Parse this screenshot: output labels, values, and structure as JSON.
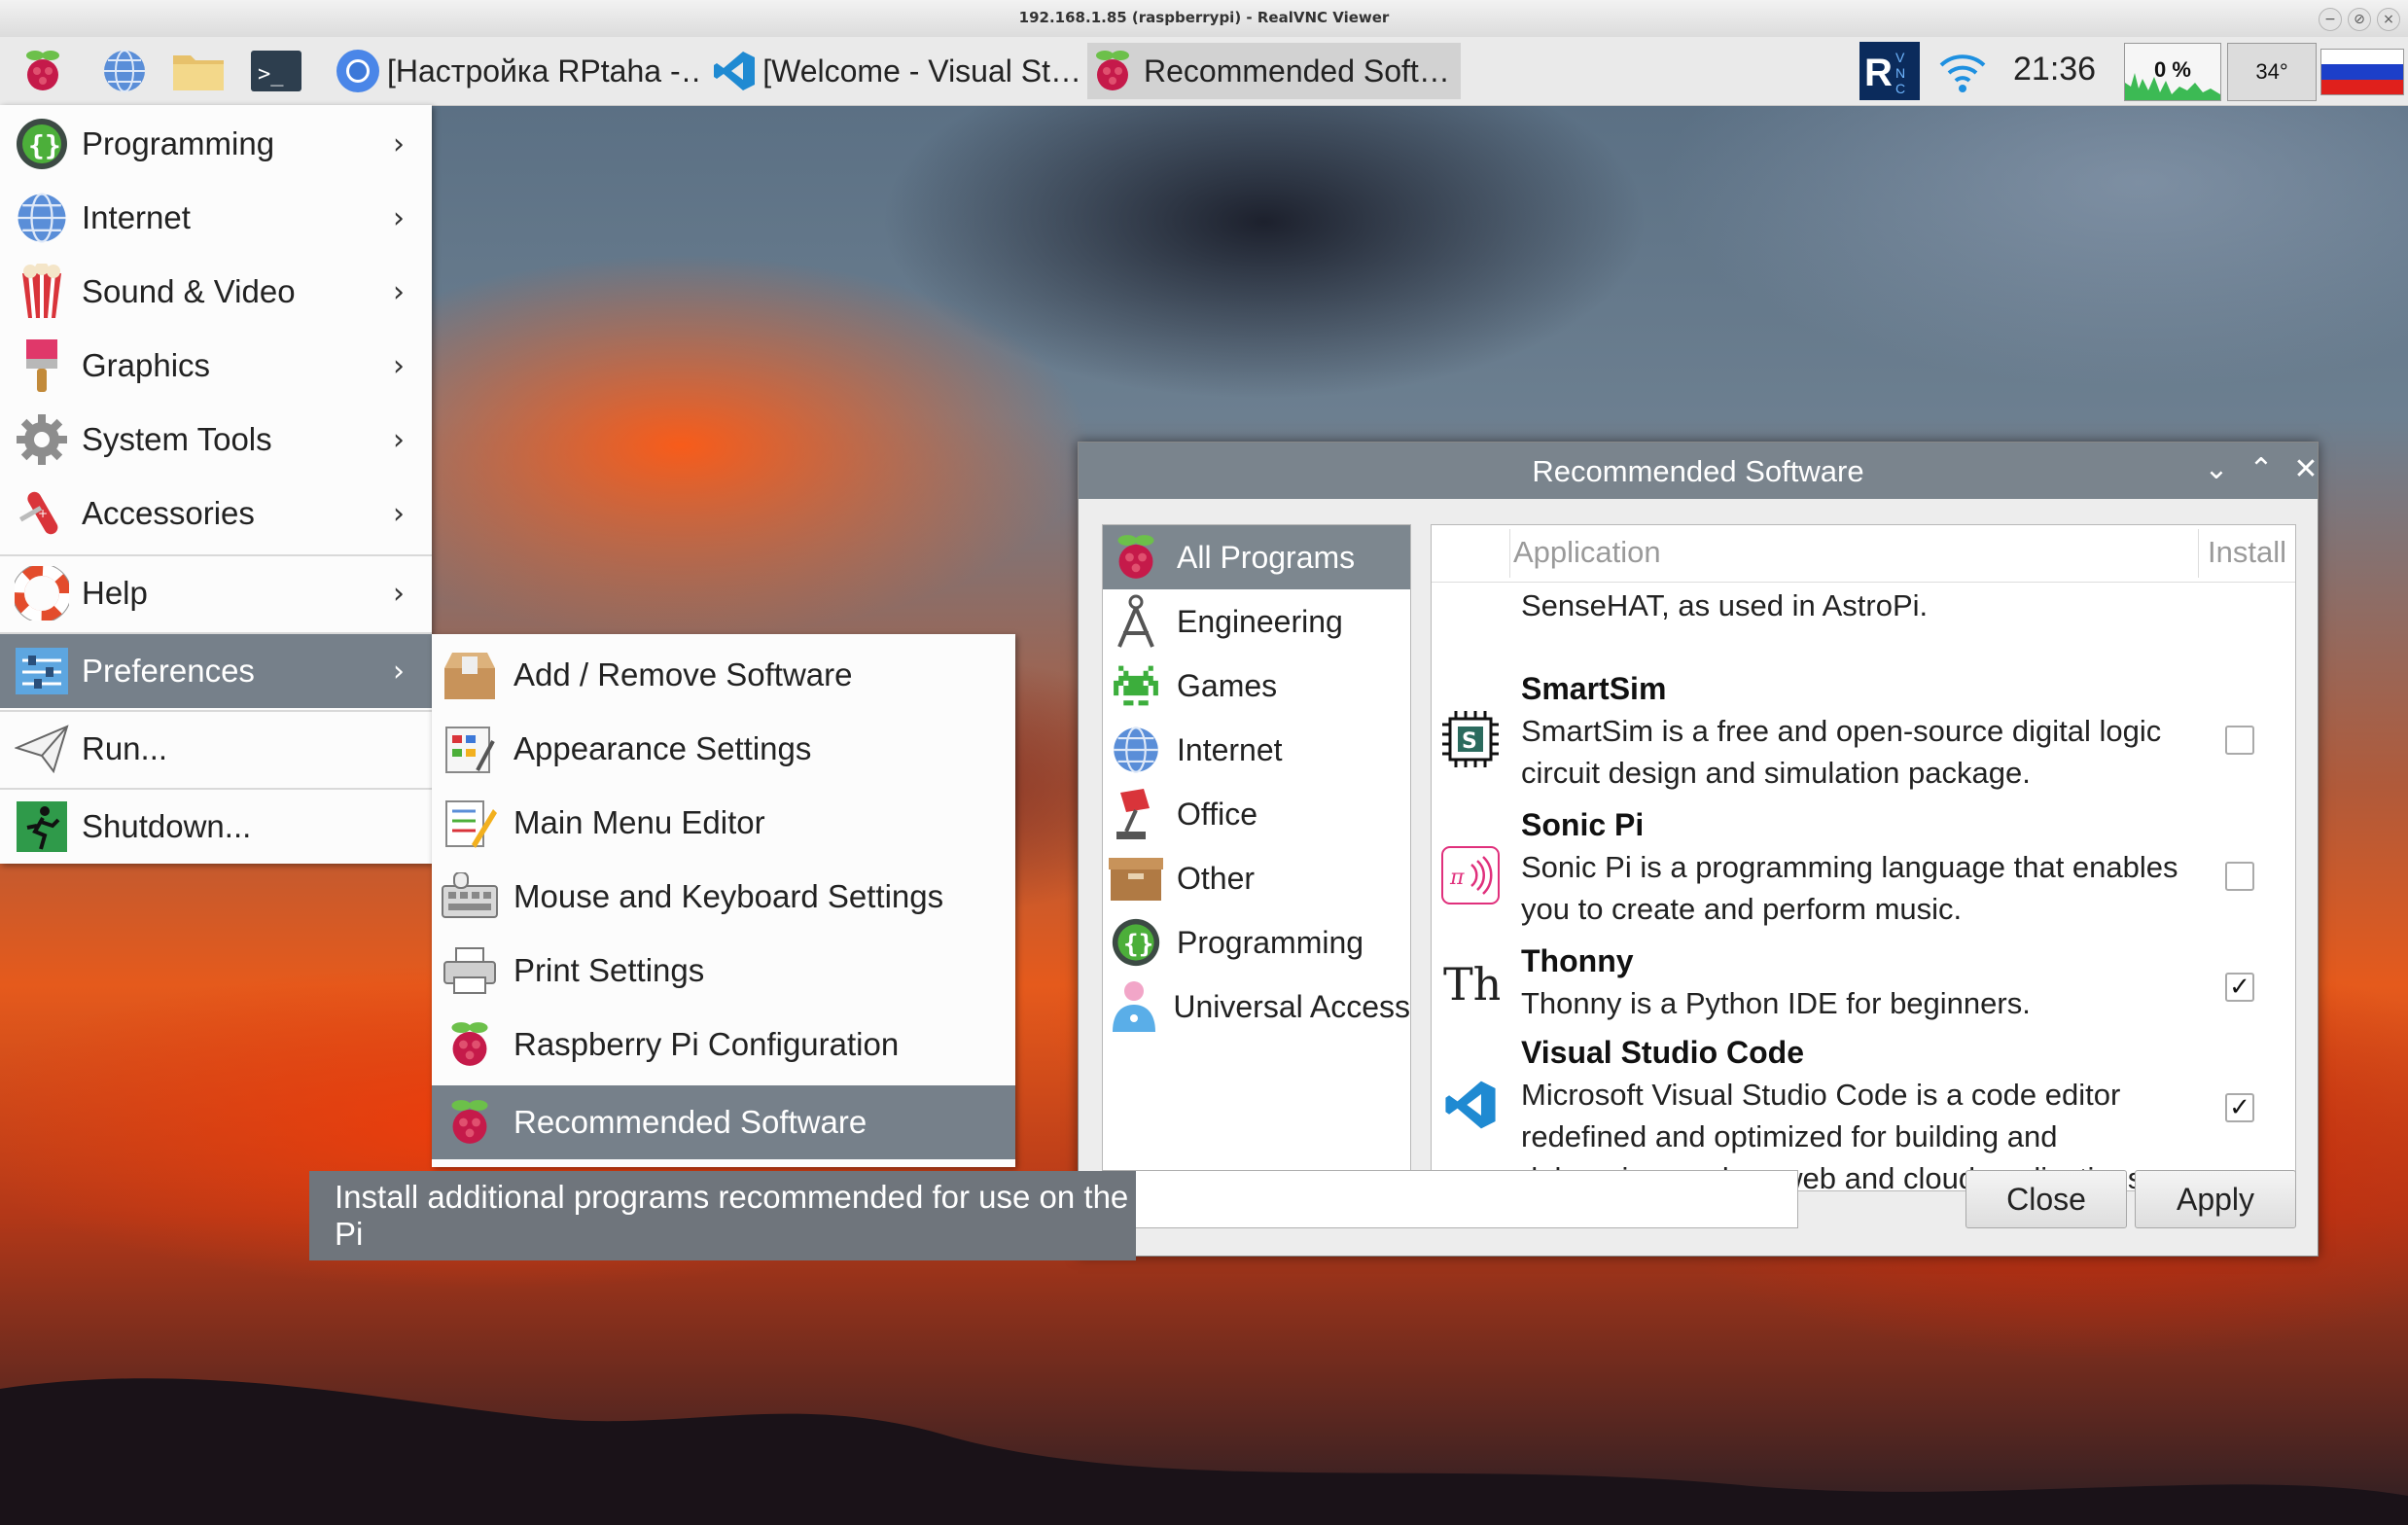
{
  "vnc": {
    "title": "192.168.1.85 (raspberrypi) - RealVNC Viewer",
    "controls": [
      "−",
      "⊘",
      "×"
    ]
  },
  "taskbar": {
    "launchers": [
      "raspberry-menu-icon",
      "browser-globe-icon",
      "file-manager-icon",
      "terminal-icon"
    ],
    "tasks": [
      {
        "label": "[Настройка RPtaha -…",
        "icon": "chromium-icon",
        "active": false
      },
      {
        "label": "[Welcome - Visual St…",
        "icon": "vscode-icon",
        "active": false
      },
      {
        "label": "Recommended Soft…",
        "icon": "raspberry-icon",
        "active": true
      }
    ],
    "clock": "21:36",
    "cpu_usage": "0 %",
    "temperature": "34°",
    "tray_icons": [
      "vnc-icon",
      "wifi-icon",
      "keyboard-layout-flag-icon"
    ]
  },
  "main_menu": {
    "items": [
      {
        "label": "Programming",
        "icon": "programming-icon",
        "submenu": true
      },
      {
        "label": "Internet",
        "icon": "internet-globe-icon",
        "submenu": true
      },
      {
        "label": "Sound & Video",
        "icon": "sound-video-icon",
        "submenu": true
      },
      {
        "label": "Graphics",
        "icon": "graphics-brush-icon",
        "submenu": true
      },
      {
        "label": "System Tools",
        "icon": "system-tools-gear-icon",
        "submenu": true
      },
      {
        "label": "Accessories",
        "icon": "accessories-knife-icon",
        "submenu": true
      },
      {
        "label": "Help",
        "icon": "help-lifebuoy-icon",
        "submenu": true
      },
      {
        "label": "Preferences",
        "icon": "preferences-sliders-icon",
        "submenu": true,
        "highlighted": true
      },
      {
        "label": "Run...",
        "icon": "run-paper-plane-icon",
        "submenu": false
      },
      {
        "label": "Shutdown...",
        "icon": "shutdown-exit-icon",
        "submenu": false
      }
    ]
  },
  "preferences_menu": {
    "items": [
      {
        "label": "Add / Remove Software",
        "icon": "add-remove-software-icon"
      },
      {
        "label": "Appearance Settings",
        "icon": "appearance-settings-icon"
      },
      {
        "label": "Main Menu Editor",
        "icon": "main-menu-editor-icon"
      },
      {
        "label": "Mouse and Keyboard Settings",
        "icon": "mouse-keyboard-icon"
      },
      {
        "label": "Print Settings",
        "icon": "printer-icon"
      },
      {
        "label": "Raspberry Pi Configuration",
        "icon": "raspberry-icon"
      },
      {
        "label": "Recommended Software",
        "icon": "raspberry-icon",
        "highlighted": true
      }
    ]
  },
  "tooltip": "Install additional programs recommended for use on the Pi",
  "recommended_software": {
    "title": "Recommended Software",
    "window_controls": [
      "⌄",
      "⌃",
      "✕"
    ],
    "categories": [
      {
        "label": "All Programs",
        "icon": "raspberry-icon",
        "selected": true
      },
      {
        "label": "Engineering",
        "icon": "engineering-compass-icon"
      },
      {
        "label": "Games",
        "icon": "games-invader-icon"
      },
      {
        "label": "Internet",
        "icon": "internet-globe-icon"
      },
      {
        "label": "Office",
        "icon": "office-lamp-icon"
      },
      {
        "label": "Other",
        "icon": "other-box-icon"
      },
      {
        "label": "Programming",
        "icon": "programming-icon"
      },
      {
        "label": "Universal Access",
        "icon": "universal-access-icon"
      }
    ],
    "columns": {
      "application": "Application",
      "install": "Install"
    },
    "apps": [
      {
        "name": "",
        "description": "A software emulator for the Raspberry Pi SenseHAT, as used in AstroPi.",
        "icon": "sense-emu-icon",
        "installed": false
      },
      {
        "name": "SmartSim",
        "description": "SmartSim is a free and open-source digital logic circuit design and simulation package.",
        "icon": "smartsim-chip-icon",
        "installed": false
      },
      {
        "name": "Sonic Pi",
        "description": "Sonic Pi is a programming language that enables you to create and perform music.",
        "icon": "sonic-pi-icon",
        "installed": false
      },
      {
        "name": "Thonny",
        "description": "Thonny is a Python IDE for beginners.",
        "icon": "thonny-icon",
        "installed": true
      },
      {
        "name": "Visual Studio Code",
        "description": "Microsoft Visual Studio Code is a code editor redefined and optimized for building and debugging modern web and cloud applications.",
        "icon": "vscode-icon",
        "installed": true
      }
    ],
    "buttons": {
      "close": "Close",
      "apply": "Apply"
    }
  },
  "colors": {
    "menu_highlight": "#76808a",
    "window_titlebar": "#7a848d",
    "tooltip_bg": "#6f757c",
    "raspberry_red": "#c51a4a",
    "raspberry_leaf": "#6cc04a"
  }
}
